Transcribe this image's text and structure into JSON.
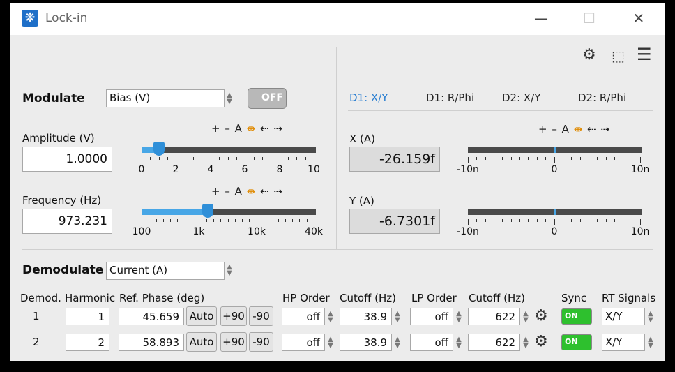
{
  "window": {
    "title": "Lock-in",
    "minimize": "—",
    "maximize": "☐",
    "close": "✕"
  },
  "toolbar": {
    "settings_icon": "gear-icon",
    "crop_icon": "crop-icon",
    "menu_icon": "menu-icon"
  },
  "modulate": {
    "label": "Modulate",
    "source": "Bias (V)",
    "toggle": "OFF",
    "amplitude": {
      "label": "Amplitude (V)",
      "value": "1.0000",
      "slider_fraction": 0.1,
      "ticks": [
        "0",
        "2",
        "4",
        "6",
        "8",
        "10"
      ]
    },
    "frequency": {
      "label": "Frequency (Hz)",
      "value": "973.231",
      "slider_fraction": 0.38,
      "ticks": [
        "100",
        "1k",
        "10k",
        "40k"
      ]
    },
    "slider_tools": {
      "plus": "+",
      "minus": "–",
      "auto": "A",
      "expand": "⇹",
      "left": "⇠",
      "right": "⇢"
    }
  },
  "tabs": [
    "D1: X/Y",
    "D1: R/Phi",
    "D2: X/Y",
    "D2: R/Phi"
  ],
  "readouts": {
    "x": {
      "label": "X (A)",
      "value": "-26.159f",
      "ticks": [
        "-10n",
        "0",
        "10n"
      ]
    },
    "y": {
      "label": "Y (A)",
      "value": "-6.7301f",
      "ticks": [
        "-10n",
        "0",
        "10n"
      ]
    }
  },
  "demodulate": {
    "label": "Demodulate",
    "source": "Current (A)",
    "headers": {
      "demod": "Demod.",
      "harmonic": "Harmonic",
      "phase": "Ref. Phase (deg)",
      "hp_order": "HP Order",
      "hp_cutoff": "Cutoff (Hz)",
      "lp_order": "LP Order",
      "lp_cutoff": "Cutoff (Hz)",
      "sync": "Sync",
      "rt": "RT Signals"
    },
    "auto_label": "Auto",
    "plus90_label": "+90",
    "minus90_label": "-90",
    "rows": [
      {
        "demod": "1",
        "harmonic": "1",
        "phase": "45.659",
        "hp_order": "off",
        "hp_cutoff": "38.9",
        "lp_order": "off",
        "lp_cutoff": "622",
        "sync": "ON",
        "rt": "X/Y"
      },
      {
        "demod": "2",
        "harmonic": "2",
        "phase": "58.893",
        "hp_order": "off",
        "hp_cutoff": "38.9",
        "lp_order": "off",
        "lp_cutoff": "622",
        "sync": "ON",
        "rt": "X/Y"
      }
    ]
  }
}
